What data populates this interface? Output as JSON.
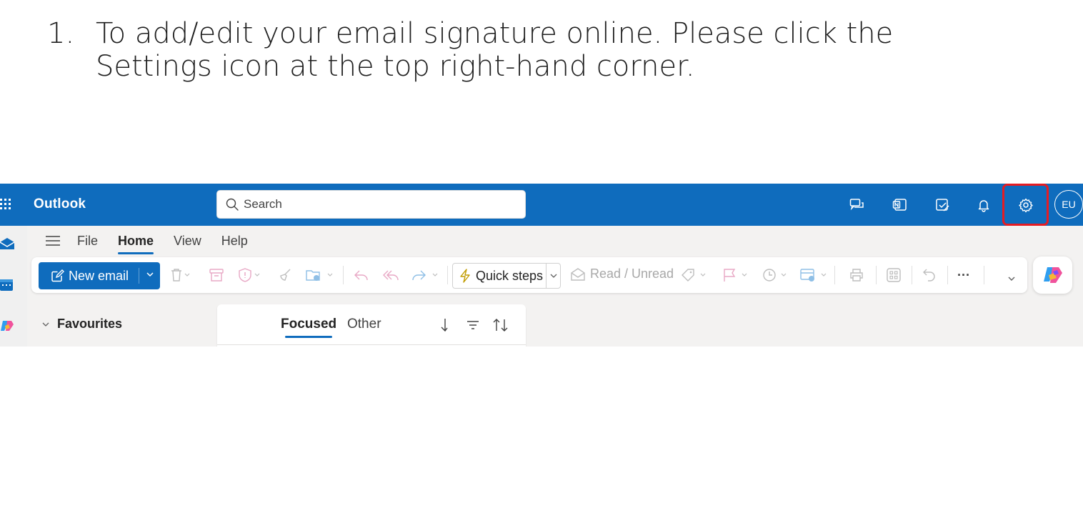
{
  "instruction": {
    "number": "1.",
    "text": "To add/edit your email signature online. Please click the Settings icon at the top right-hand corner."
  },
  "header": {
    "app_name": "Outlook",
    "search_placeholder": "Search",
    "avatar_initials": "EU",
    "brand_color": "#0f6cbd",
    "highlight_color": "#e51c23",
    "icons": [
      "chat-icon",
      "onenote-icon",
      "todo-icon",
      "bell-icon",
      "settings-icon"
    ]
  },
  "menu": {
    "items": [
      "File",
      "Home",
      "View",
      "Help"
    ],
    "active": "Home"
  },
  "ribbon": {
    "new_email": "New email",
    "quick_steps": "Quick steps",
    "read_unread": "Read / Unread",
    "more": "···"
  },
  "folders": {
    "favourites": "Favourites"
  },
  "message_list": {
    "tabs": [
      "Focused",
      "Other"
    ],
    "active_tab": "Focused"
  }
}
